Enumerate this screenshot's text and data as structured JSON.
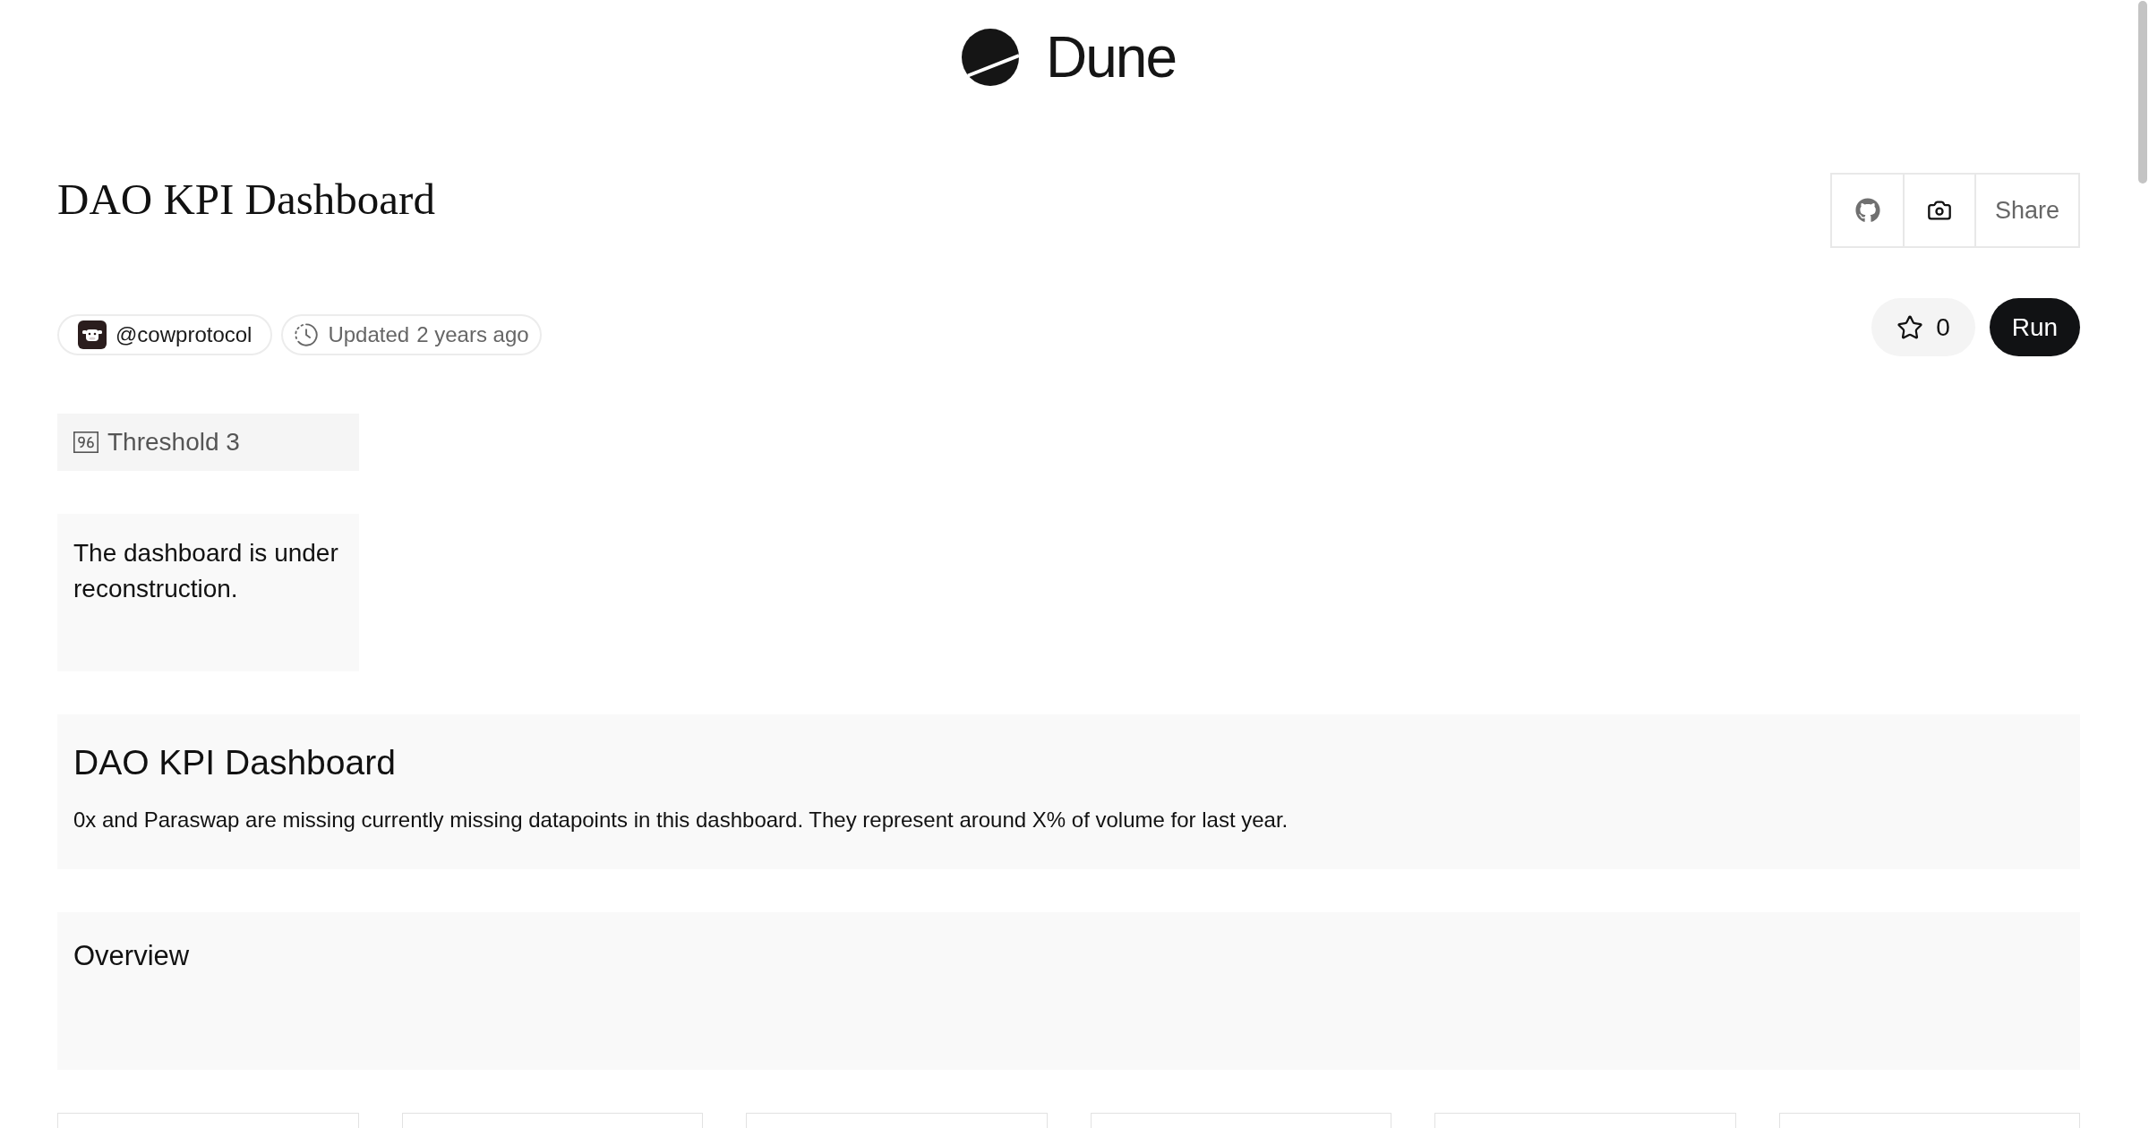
{
  "header": {
    "logo_text": "Dune"
  },
  "dashboard": {
    "title": "DAO KPI Dashboard",
    "share_button": "Share",
    "author": "@cowprotocol",
    "updated_label": "Updated",
    "updated_time": "2 years ago",
    "star_button": {
      "count": "0",
      "starred": false
    },
    "run_button": "Run"
  },
  "widgets": [
    {
      "kind": "parameter",
      "label": "Threshold 3"
    },
    {
      "kind": "note",
      "text": "The dashboard is under reconstruction."
    },
    {
      "kind": "header_card",
      "heading": "DAO KPI Dashboard",
      "text": "0x and Paraswap are missing currently missing datapoints in this dashboard. They represent around X% of volume for last year."
    },
    {
      "kind": "section_card",
      "heading": "Overview"
    },
    {
      "kind": "panel"
    },
    {
      "kind": "panel"
    },
    {
      "kind": "panel"
    },
    {
      "kind": "panel"
    },
    {
      "kind": "panel"
    },
    {
      "kind": "panel"
    }
  ]
}
